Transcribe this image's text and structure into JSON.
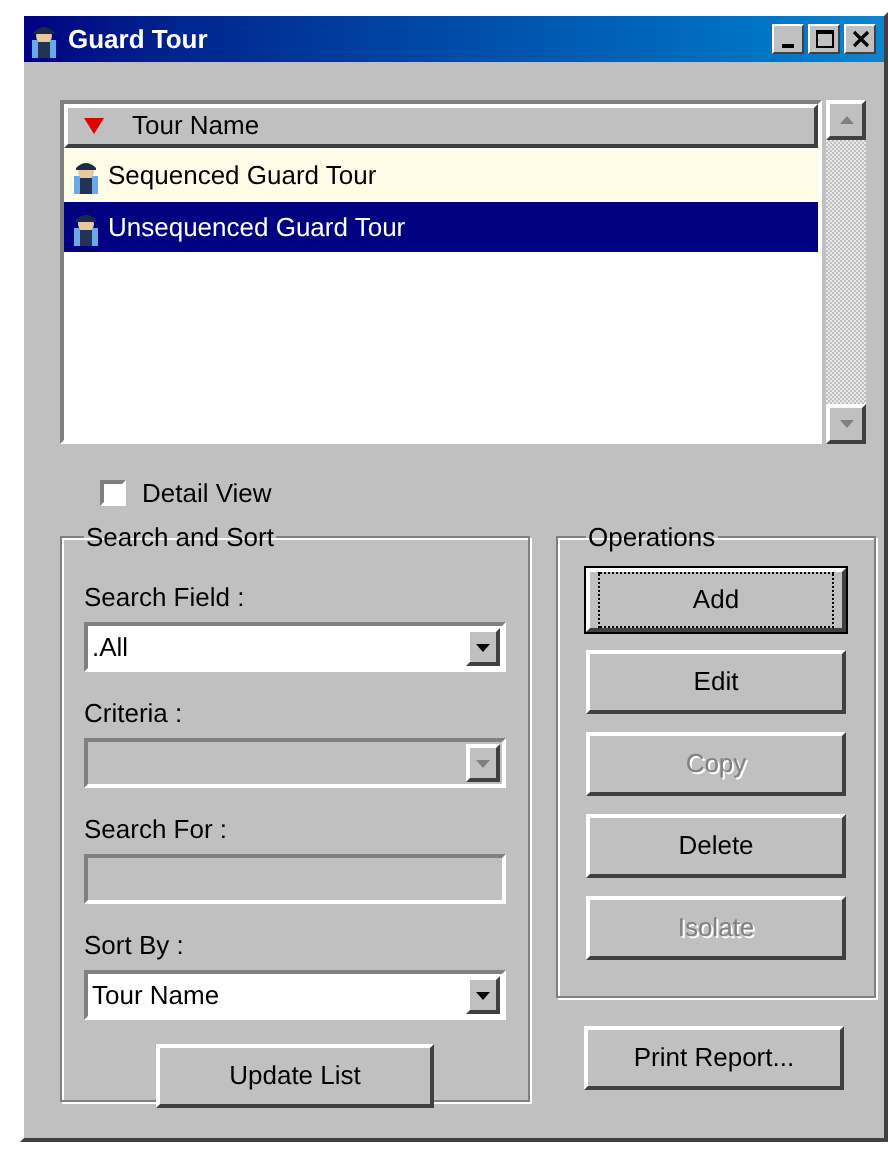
{
  "window": {
    "title": "Guard Tour"
  },
  "list": {
    "column": "Tour Name",
    "rows": [
      {
        "label": "Sequenced Guard Tour",
        "selected": false,
        "hover": true
      },
      {
        "label": "Unsequenced Guard Tour",
        "selected": true,
        "hover": false
      }
    ]
  },
  "detail_view": {
    "label": "Detail View",
    "checked": false
  },
  "search_and_sort": {
    "title": "Search and Sort",
    "fields": [
      {
        "label": "Search Field :",
        "kind": "select",
        "value": ".All",
        "disabled": false
      },
      {
        "label": "Criteria :",
        "kind": "select",
        "disabled": true
      },
      {
        "label": "Search For :",
        "kind": "text",
        "disabled": true
      },
      {
        "label": "Sort By :",
        "kind": "select",
        "value": "Tour Name",
        "disabled": false
      }
    ],
    "button": "Update List"
  },
  "operations": {
    "title": "Operations",
    "buttons": [
      {
        "label": "Add",
        "disabled": false,
        "focused": true
      },
      {
        "label": "Edit",
        "disabled": false,
        "focused": false
      },
      {
        "label": "Copy",
        "disabled": true,
        "focused": false
      },
      {
        "label": "Delete",
        "disabled": false,
        "focused": false
      },
      {
        "label": "Isolate",
        "disabled": true,
        "focused": false
      }
    ]
  },
  "print_button": "Print Report..."
}
